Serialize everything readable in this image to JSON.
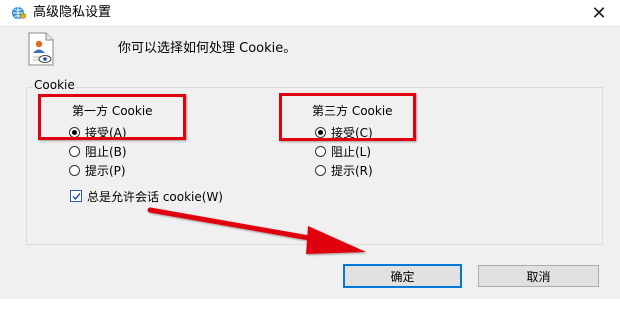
{
  "window": {
    "title": "高级隐私设置",
    "close_glyph": "✕"
  },
  "intro_text": "你可以选择如何处理 Cookie。",
  "group": {
    "label": "Cookie",
    "first_party": {
      "title": "第一方 Cookie",
      "options": [
        {
          "label": "接受(A)",
          "selected": true
        },
        {
          "label": "阻止(B)",
          "selected": false
        },
        {
          "label": "提示(P)",
          "selected": false
        }
      ]
    },
    "third_party": {
      "title": "第三方 Cookie",
      "options": [
        {
          "label": "接受(C)",
          "selected": true
        },
        {
          "label": "阻止(L)",
          "selected": false
        },
        {
          "label": "提示(R)",
          "selected": false
        }
      ]
    },
    "session_checkbox": {
      "label": "总是允许会话 cookie(W)",
      "checked": true
    }
  },
  "buttons": {
    "ok": "确定",
    "cancel": "取消"
  },
  "annotation_color": "#e0000f",
  "icons": {
    "title": "globe-shield-icon",
    "info": "privacy-document-icon"
  }
}
